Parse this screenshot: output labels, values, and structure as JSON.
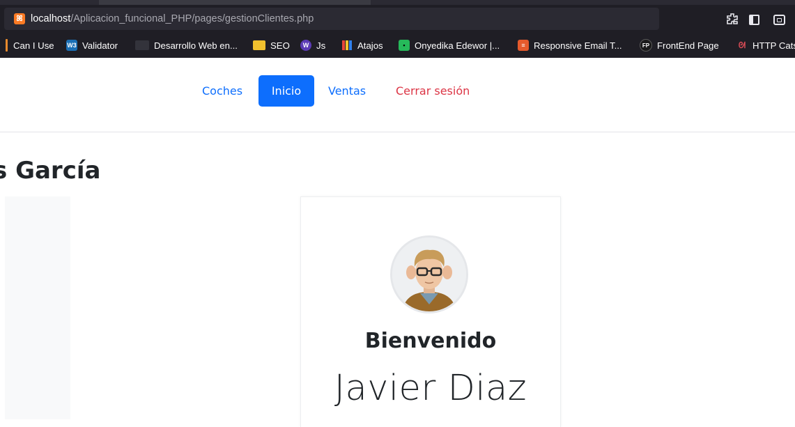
{
  "browser": {
    "url_host": "localhost",
    "url_path": "/Aplicacion_funcional_PHP/pages/gestionClientes.php",
    "bookmarks": [
      {
        "label": "Can I Use",
        "icon": "caniuse-icon"
      },
      {
        "label": "Validator",
        "icon": "w3c-icon",
        "icon_text": "W3"
      },
      {
        "label": "Desarrollo Web en...",
        "icon": "monitor-icon"
      },
      {
        "label": "SEO",
        "icon": "folder-icon"
      },
      {
        "label": "Js",
        "icon": "w-icon",
        "icon_text": "W"
      },
      {
        "label": "Atajos",
        "icon": "bars-icon"
      },
      {
        "label": "Onyedika Edewor |...",
        "icon": "square-icon"
      },
      {
        "label": "Responsive Email T...",
        "icon": "email-icon"
      },
      {
        "label": "FrontEnd Page",
        "icon": "fp-icon",
        "icon_text": "FP"
      },
      {
        "label": "HTTP Cats",
        "icon": "cat-icon"
      }
    ]
  },
  "nav": {
    "coches": "Coches",
    "inicio": "Inicio",
    "ventas": "Ventas",
    "logout": "Cerrar sesión"
  },
  "main": {
    "heading": "s García",
    "welcome": "Bienvenido",
    "user_name": "Javier Diaz"
  },
  "colors": {
    "primary": "#0d6efd",
    "danger": "#dc3545",
    "chrome_bg": "#1f1e25",
    "text_dark": "#212529"
  }
}
